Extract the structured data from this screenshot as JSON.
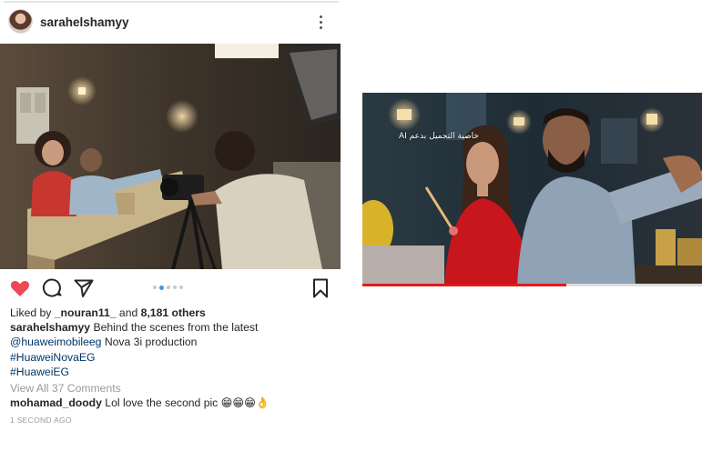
{
  "post": {
    "username": "sarahelshamyy",
    "liked_by_prefix": "Liked by ",
    "liked_by_user": "_nouran11_",
    "liked_by_and": " and ",
    "likes_count": "8,181 others",
    "caption_user": "sarahelshamyy",
    "caption_text_1": " Behind the scenes from the latest",
    "caption_mention": "@huaweimobileeg",
    "caption_text_2": " Nova 3i production",
    "hashtag_1": "#HuaweiNovaEG",
    "hashtag_2": "#HuaweiEG",
    "view_comments": "View All 37 Comments",
    "comment_user": "mohamad_doody",
    "comment_text": " Lol love the second pic 😁😁😁👌",
    "timestamp": "1 SECOND AGO",
    "carousel_total": 5,
    "carousel_active": 1,
    "liked": true
  },
  "video": {
    "overlay_text": "خاصية التجميل بدعم AI",
    "progress": 0.6
  },
  "icons": {
    "heart": "heart-icon",
    "comment": "comment-icon",
    "share": "share-icon",
    "bookmark": "bookmark-icon",
    "more": "more-vertical-icon",
    "user_tag": "person-icon"
  },
  "colors": {
    "like_red": "#ed4956",
    "link_blue": "#003569",
    "muted_gray": "#999999",
    "dot_active": "#3897f0",
    "progress_red": "#e01b1b"
  }
}
